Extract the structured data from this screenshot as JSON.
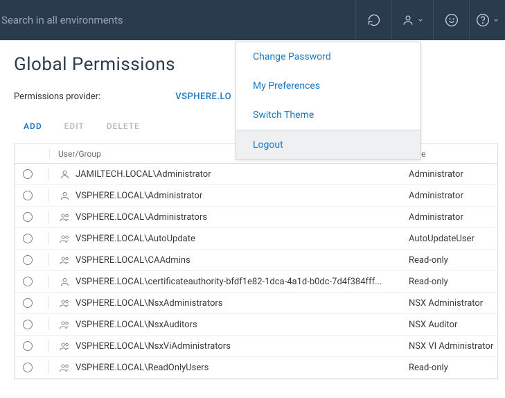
{
  "search": {
    "placeholder": "Search in all environments"
  },
  "page": {
    "title": "Global Permissions"
  },
  "provider": {
    "label": "Permissions provider:",
    "value": "VSPHERE.LO"
  },
  "actions": {
    "add": "ADD",
    "edit": "EDIT",
    "delete": "DELETE"
  },
  "columns": {
    "user": "User/Group",
    "role": "Role"
  },
  "menu": {
    "change_password": "Change Password",
    "my_preferences": "My Preferences",
    "switch_theme": "Switch Theme",
    "logout": "Logout"
  },
  "rows": [
    {
      "type": "user",
      "name": "JAMILTECH.LOCAL\\Administrator",
      "role": "Administrator"
    },
    {
      "type": "user",
      "name": "VSPHERE.LOCAL\\Administrator",
      "role": "Administrator"
    },
    {
      "type": "group",
      "name": "VSPHERE.LOCAL\\Administrators",
      "role": "Administrator"
    },
    {
      "type": "group",
      "name": "VSPHERE.LOCAL\\AutoUpdate",
      "role": "AutoUpdateUser"
    },
    {
      "type": "group",
      "name": "VSPHERE.LOCAL\\CAAdmins",
      "role": "Read-only"
    },
    {
      "type": "user",
      "name": "VSPHERE.LOCAL\\certificateauthority-bfdf1e82-1dca-4a1d-b0dc-7d4f384fff...",
      "role": "Read-only"
    },
    {
      "type": "group",
      "name": "VSPHERE.LOCAL\\NsxAdministrators",
      "role": "NSX Administrator"
    },
    {
      "type": "group",
      "name": "VSPHERE.LOCAL\\NsxAuditors",
      "role": "NSX Auditor"
    },
    {
      "type": "group",
      "name": "VSPHERE.LOCAL\\NsxViAdministrators",
      "role": "NSX VI Administrator"
    },
    {
      "type": "group",
      "name": "VSPHERE.LOCAL\\ReadOnlyUsers",
      "role": "Read-only"
    }
  ]
}
